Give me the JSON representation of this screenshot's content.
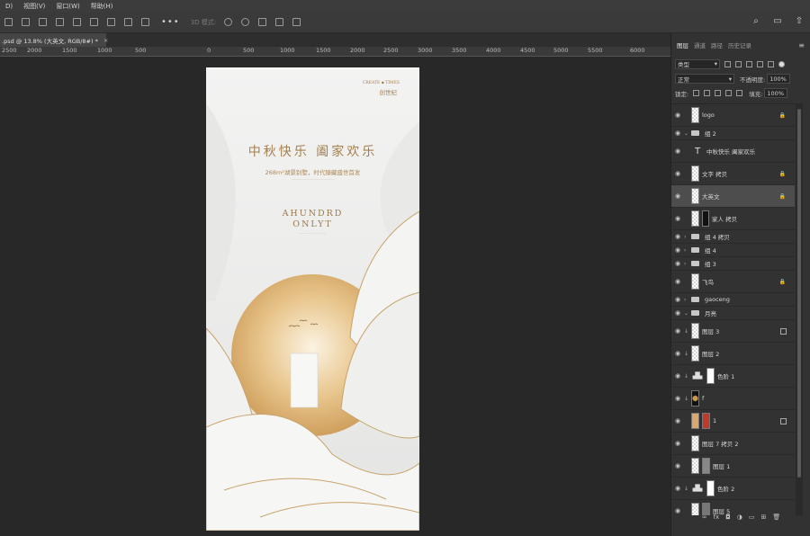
{
  "menu": [
    "D)",
    "视图(V)",
    "窗口(W)",
    "帮助(H)"
  ],
  "options_bar": {
    "mode3d": "3D 模式:"
  },
  "doc_tab": {
    "title": ".psd @ 13.8% (大英文, RGB/8#) *",
    "close": "×"
  },
  "ruler": [
    "2500",
    "2000",
    "1500",
    "1000",
    "500",
    "0",
    "500",
    "1000",
    "1500",
    "2000",
    "2500",
    "3000",
    "3500",
    "4000",
    "4500",
    "5000",
    "5500",
    "6000"
  ],
  "poster": {
    "brand_en": "CREATE ▪ TIMES",
    "brand_cn": "创世纪",
    "headline": "中秋快乐  阖家欢乐",
    "subline": "268m²湖景别墅，时代臻藏盛世首发",
    "eng_line1": "AHUNDRD",
    "eng_line2": "ONLYT"
  },
  "panel": {
    "tabs": [
      "图层",
      "通道",
      "路径",
      "历史记录"
    ],
    "filter_label": "类型",
    "blend_mode": "正常",
    "opacity_label": "不透明度:",
    "opacity_value": "100%",
    "lock_label": "锁定:",
    "fill_label": "填充:",
    "fill_value": "100%"
  },
  "layers": [
    {
      "name": "logo",
      "type": "layer",
      "lock": true
    },
    {
      "name": "组 2",
      "type": "group",
      "open": true
    },
    {
      "name": "中秋快乐 阖家欢乐",
      "type": "text"
    },
    {
      "name": "文字 拷贝",
      "type": "layer",
      "lock": true
    },
    {
      "name": "大英文",
      "type": "layer",
      "lock": true,
      "selected": true
    },
    {
      "name": "家人 拷贝",
      "type": "layer"
    },
    {
      "name": "组 4 拷贝",
      "type": "group"
    },
    {
      "name": "组 4",
      "type": "group"
    },
    {
      "name": "组 3",
      "type": "group"
    },
    {
      "name": "飞鸟",
      "type": "layer",
      "lock": true
    },
    {
      "name": "gaoceng",
      "type": "group"
    },
    {
      "name": "月亮",
      "type": "group",
      "open": true
    },
    {
      "name": "图层 3",
      "type": "layer",
      "smart": true
    },
    {
      "name": "图层 2",
      "type": "layer"
    },
    {
      "name": "色阶 1",
      "type": "adjust"
    },
    {
      "name": "f",
      "type": "layer"
    },
    {
      "name": "1",
      "type": "layer",
      "smart": true
    },
    {
      "name": "图层 7 拷贝 2",
      "type": "layer"
    },
    {
      "name": "图层 1",
      "type": "layer"
    },
    {
      "name": "色阶 2",
      "type": "adjust"
    },
    {
      "name": "图层 5",
      "type": "layer"
    }
  ]
}
